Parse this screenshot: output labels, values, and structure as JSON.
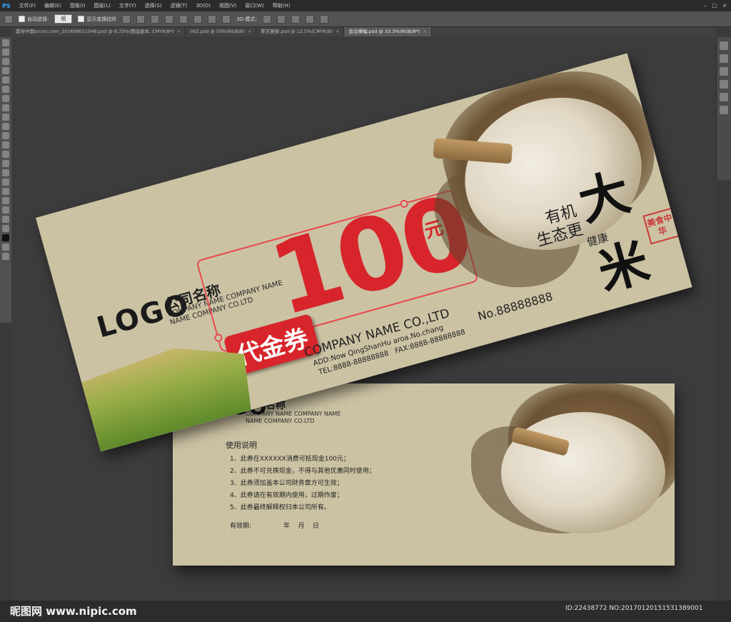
{
  "app": {
    "logo_text": "PS",
    "menus": [
      "文件(F)",
      "编辑(E)",
      "图像(I)",
      "图层(L)",
      "文字(Y)",
      "选择(S)",
      "滤镜(T)",
      "3D(D)",
      "视图(V)",
      "窗口(W)",
      "帮助(H)"
    ]
  },
  "options": {
    "auto_select_label": "自动选择:",
    "auto_select_value": "组",
    "show_transform_label": "显示变换控件",
    "mode_label": "3D 模式:"
  },
  "tabs": [
    {
      "label": "素材中国sccnn.com_201608011048.psd @ 8.33%(图层副本, CMYK/8*)",
      "close": "×"
    },
    {
      "label": "002.psd @ 50%(RGB/8)",
      "close": "×"
    },
    {
      "label": "茶艺展架.psd @ 12.5%(CMYK/8)",
      "close": "×"
    },
    {
      "label": "会议横幅.psd @ 33.3%(RGB/8*)",
      "close": "×"
    }
  ],
  "front": {
    "logo": "LOGO",
    "company_cn": "公司名称",
    "company_en1": "COMPANY NAME COMPANY NAME",
    "company_en2": "NAME COMPANY CO.LTD",
    "amount": "100",
    "unit": "元",
    "voucher": "代金券",
    "company_name": "COMPANY NAME CO.,LTD",
    "address": "ADD:Now QingShanHu aroa.No.chang",
    "tel": "TEL:8888-88888888   FAX:8888-88888888",
    "number": "No.88888888",
    "slogan1": "有机",
    "slogan2": "生态更",
    "slogan3": "健康",
    "product": "大米",
    "seal": "美食中华"
  },
  "back": {
    "logo": "LOGO",
    "company_cn": "公司名称",
    "company_en1": "COMPANY NAME COMPANY NAME",
    "company_en2": "NAME COMPANY CO.LTD",
    "usage_title": "使用说明",
    "rules": [
      "1、此券在XXXXXX消费可抵现金100元；",
      "2、此券不可兑换现金，不得与其他优惠同时使用；",
      "3、此券须加盖本公司财务章方可生效；",
      "4、此券请在有效期内使用，过期作废；",
      "5、此券最终解释权归本公司所有。"
    ],
    "valid_label": "有效期:",
    "valid_fields": "年    月    日"
  },
  "watermark": {
    "left": "昵图网 www.nipic.com",
    "right": "ID:22438772 NO:20170120151531389001"
  },
  "colors": {
    "accent_red": "#d7252b",
    "paper": "#cfc6a8",
    "ps_blue": "#31a8ff"
  }
}
